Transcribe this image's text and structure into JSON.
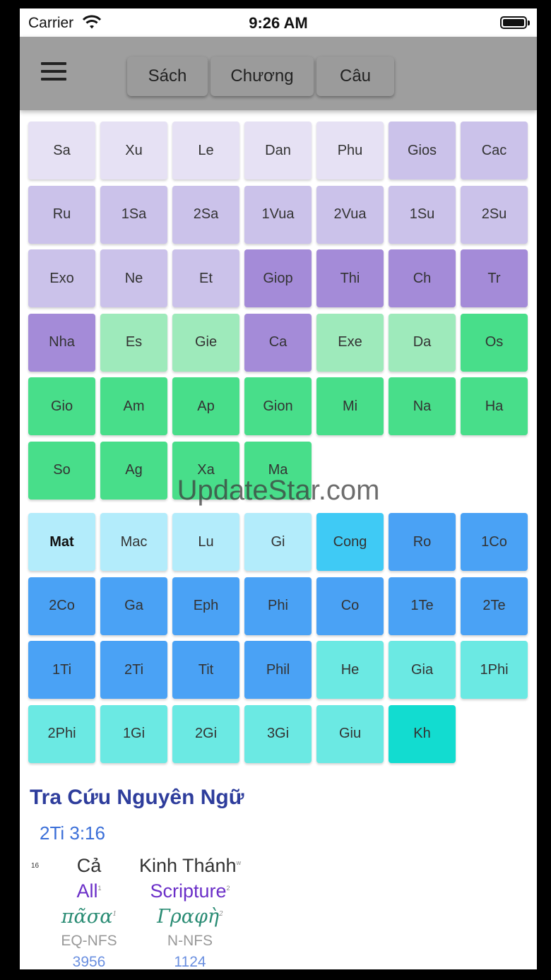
{
  "status": {
    "carrier": "Carrier",
    "time": "9:26 AM"
  },
  "nav": {
    "tabs": [
      "Sách",
      "Chương",
      "Câu"
    ]
  },
  "books_ot": [
    {
      "label": "Sa",
      "color": "#e6e1f4"
    },
    {
      "label": "Xu",
      "color": "#e6e1f4"
    },
    {
      "label": "Le",
      "color": "#e6e1f4"
    },
    {
      "label": "Dan",
      "color": "#e6e1f4"
    },
    {
      "label": "Phu",
      "color": "#e6e1f4"
    },
    {
      "label": "Gios",
      "color": "#cbc2ea"
    },
    {
      "label": "Cac",
      "color": "#cbc2ea"
    },
    {
      "label": "Ru",
      "color": "#cbc2ea"
    },
    {
      "label": "1Sa",
      "color": "#cbc2ea"
    },
    {
      "label": "2Sa",
      "color": "#cbc2ea"
    },
    {
      "label": "1Vua",
      "color": "#cbc2ea"
    },
    {
      "label": "2Vua",
      "color": "#cbc2ea"
    },
    {
      "label": "1Su",
      "color": "#cbc2ea"
    },
    {
      "label": "2Su",
      "color": "#cbc2ea"
    },
    {
      "label": "Exo",
      "color": "#cbc2ea"
    },
    {
      "label": "Ne",
      "color": "#cbc2ea"
    },
    {
      "label": "Et",
      "color": "#cbc2ea"
    },
    {
      "label": "Giop",
      "color": "#a48bd8"
    },
    {
      "label": "Thi",
      "color": "#a48bd8"
    },
    {
      "label": "Ch",
      "color": "#a48bd8"
    },
    {
      "label": "Tr",
      "color": "#a48bd8"
    },
    {
      "label": "Nha",
      "color": "#a48bd8"
    },
    {
      "label": "Es",
      "color": "#9eeabb"
    },
    {
      "label": "Gie",
      "color": "#9eeabb"
    },
    {
      "label": "Ca",
      "color": "#a48bd8"
    },
    {
      "label": "Exe",
      "color": "#9eeabb"
    },
    {
      "label": "Da",
      "color": "#9eeabb"
    },
    {
      "label": "Os",
      "color": "#48de8a"
    },
    {
      "label": "Gio",
      "color": "#48de8a"
    },
    {
      "label": "Am",
      "color": "#48de8a"
    },
    {
      "label": "Ap",
      "color": "#48de8a"
    },
    {
      "label": "Gion",
      "color": "#48de8a"
    },
    {
      "label": "Mi",
      "color": "#48de8a"
    },
    {
      "label": "Na",
      "color": "#48de8a"
    },
    {
      "label": "Ha",
      "color": "#48de8a"
    },
    {
      "label": "So",
      "color": "#48de8a"
    },
    {
      "label": "Ag",
      "color": "#48de8a"
    },
    {
      "label": "Xa",
      "color": "#48de8a"
    },
    {
      "label": "Ma",
      "color": "#48de8a"
    }
  ],
  "books_nt": [
    {
      "label": "Mat",
      "color": "#b3ecfb",
      "bold": true
    },
    {
      "label": "Mac",
      "color": "#b3ecfb"
    },
    {
      "label": "Lu",
      "color": "#b3ecfb"
    },
    {
      "label": "Gi",
      "color": "#b3ecfb"
    },
    {
      "label": "Cong",
      "color": "#3fcaf5"
    },
    {
      "label": "Ro",
      "color": "#4aa2f5"
    },
    {
      "label": "1Co",
      "color": "#4aa2f5"
    },
    {
      "label": "2Co",
      "color": "#4aa2f5"
    },
    {
      "label": "Ga",
      "color": "#4aa2f5"
    },
    {
      "label": "Eph",
      "color": "#4aa2f5"
    },
    {
      "label": "Phi",
      "color": "#4aa2f5"
    },
    {
      "label": "Co",
      "color": "#4aa2f5"
    },
    {
      "label": "1Te",
      "color": "#4aa2f5"
    },
    {
      "label": "2Te",
      "color": "#4aa2f5"
    },
    {
      "label": "1Ti",
      "color": "#4aa2f5"
    },
    {
      "label": "2Ti",
      "color": "#4aa2f5"
    },
    {
      "label": "Tit",
      "color": "#4aa2f5"
    },
    {
      "label": "Phil",
      "color": "#4aa2f5"
    },
    {
      "label": "He",
      "color": "#6be9e3"
    },
    {
      "label": "Gia",
      "color": "#6be9e3"
    },
    {
      "label": "1Phi",
      "color": "#6be9e3"
    },
    {
      "label": "2Phi",
      "color": "#6be9e3"
    },
    {
      "label": "1Gi",
      "color": "#6be9e3"
    },
    {
      "label": "2Gi",
      "color": "#6be9e3"
    },
    {
      "label": "3Gi",
      "color": "#6be9e3"
    },
    {
      "label": "Giu",
      "color": "#6be9e3"
    },
    {
      "label": "Kh",
      "color": "#12dcd0"
    }
  ],
  "watermark": "UpdateStar.com",
  "lookup": {
    "title": "Tra Cứu Nguyên Ngữ",
    "reference": "2Ti 3:16",
    "verse_number": "16",
    "words": [
      {
        "vn": "Cả",
        "vn_sup": "",
        "en": "All",
        "en_sup": "1",
        "gr": "πᾶσα",
        "gr_sup": "1",
        "pos": "EQ-NFS",
        "num": "3956"
      },
      {
        "vn": "Kinh Thánh",
        "vn_sup": "w",
        "en": "Scripture",
        "en_sup": "2",
        "gr": "Γραφὴ",
        "gr_sup": "2",
        "pos": "N-NFS",
        "num": "1124"
      }
    ]
  }
}
